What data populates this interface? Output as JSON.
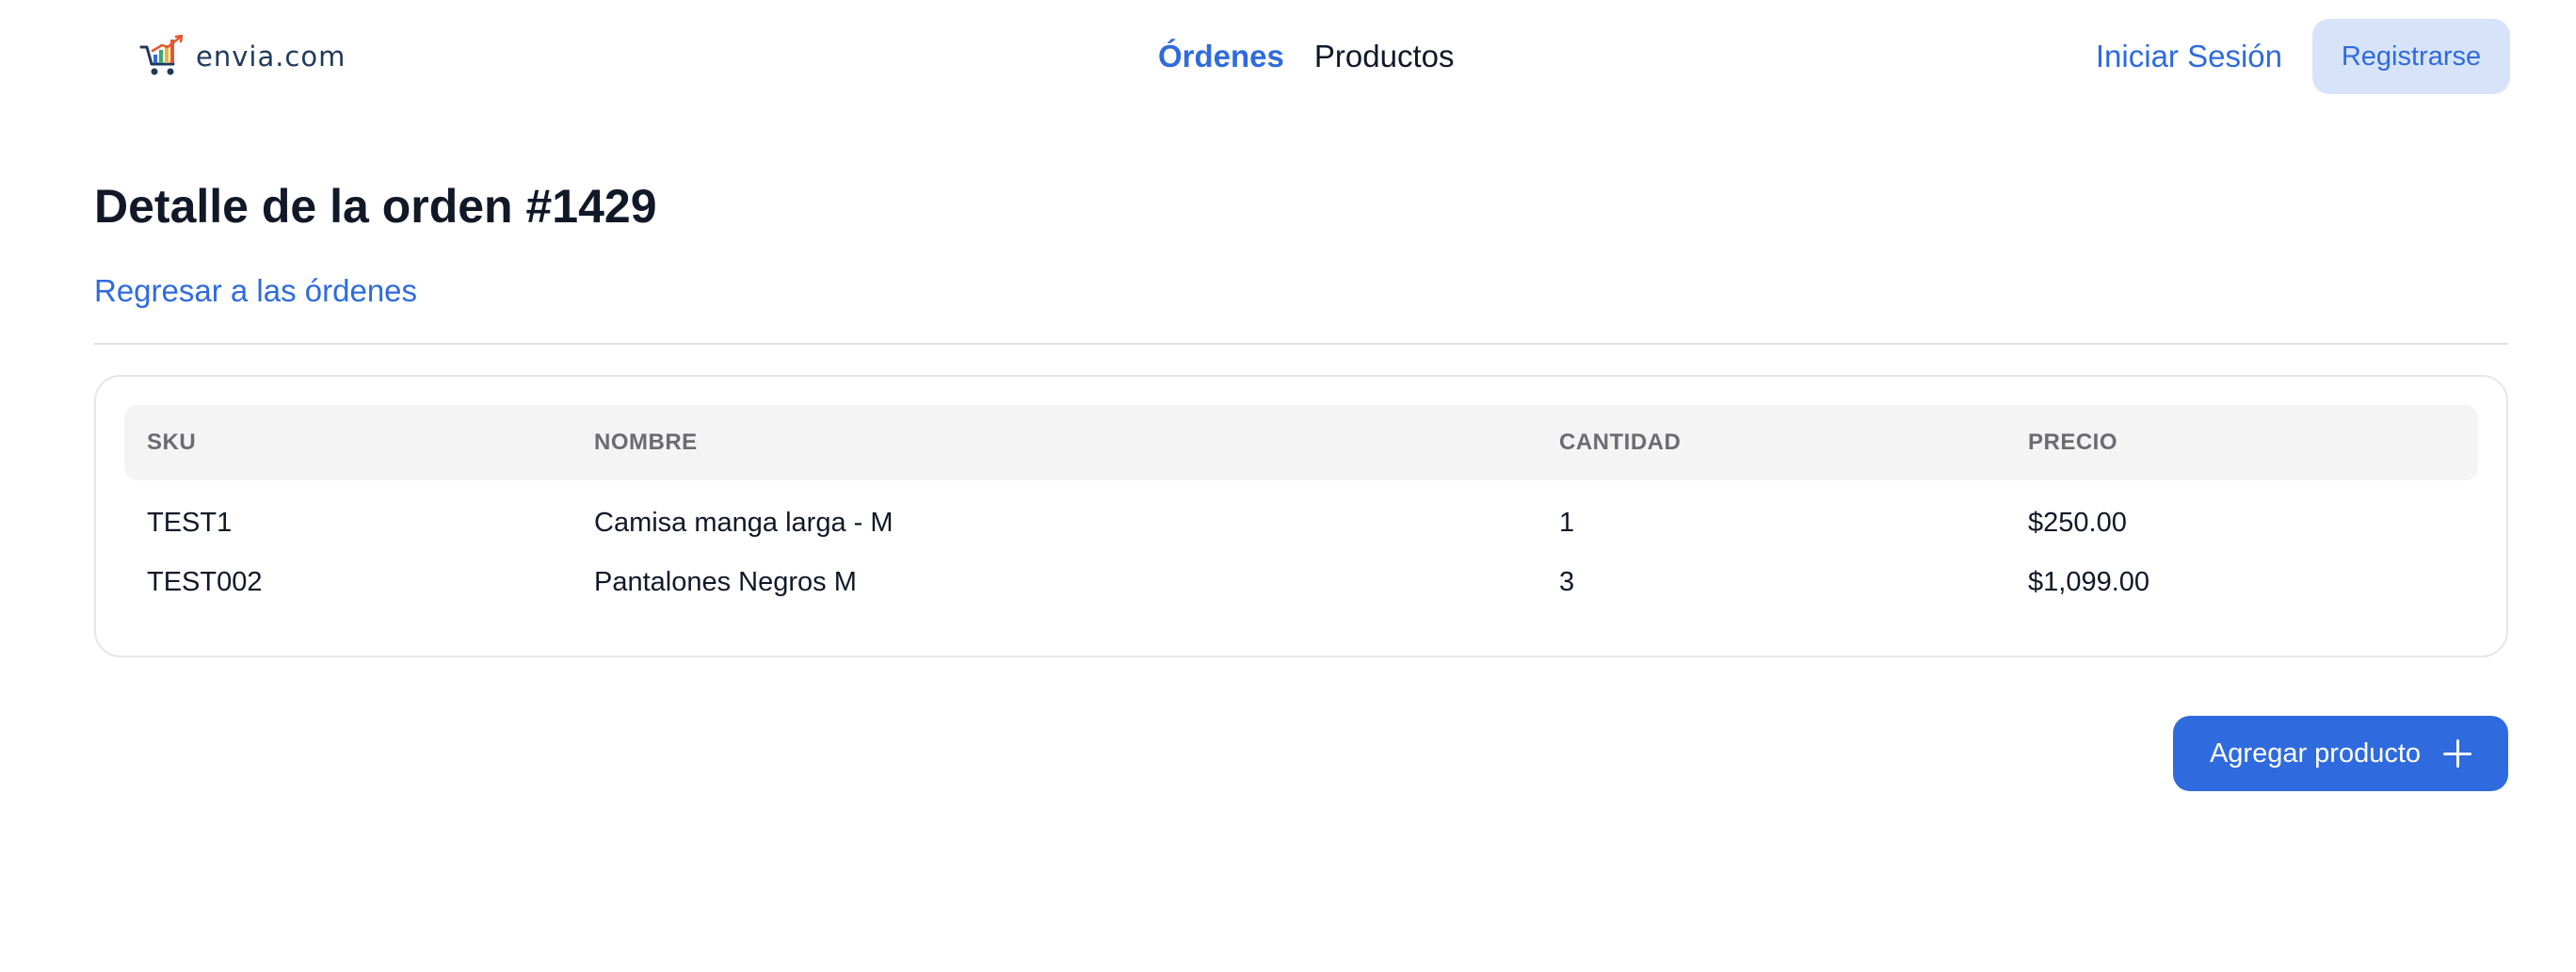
{
  "header": {
    "logo_text": "envia.com",
    "nav": [
      {
        "label": "Órdenes",
        "active": true
      },
      {
        "label": "Productos",
        "active": false
      }
    ],
    "login_label": "Iniciar Sesión",
    "register_label": "Registrarse"
  },
  "main": {
    "title": "Detalle de la orden #1429",
    "back_link": "Regresar a las órdenes",
    "table": {
      "headers": [
        "SKU",
        "NOMBRE",
        "CANTIDAD",
        "PRECIO"
      ],
      "rows": [
        [
          "TEST1",
          "Camisa manga larga - M",
          "1",
          "$250.00"
        ],
        [
          "TEST002",
          "Pantalones Negros M",
          "3",
          "$1,099.00"
        ]
      ]
    },
    "add_button_label": "Agregar producto"
  },
  "colors": {
    "accent": "#2f6bde",
    "accent_light": "#d7e3f8",
    "text": "#111827",
    "muted": "#6b6b70"
  },
  "icons": {
    "logo": "cart-chart-icon",
    "add": "plus-icon"
  }
}
